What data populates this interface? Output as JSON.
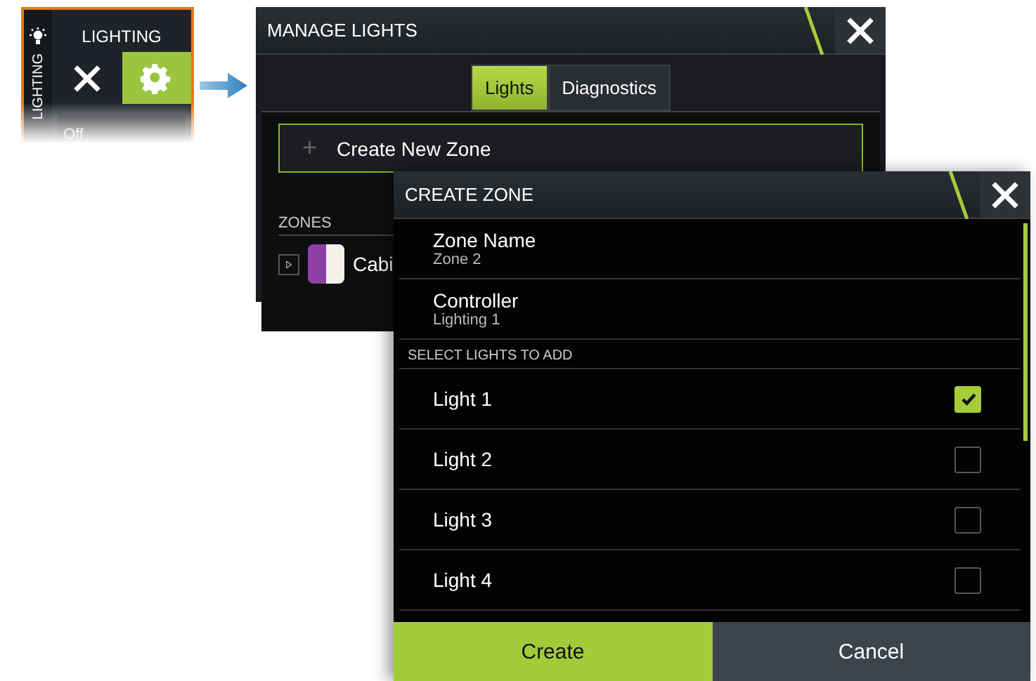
{
  "lighting_panel": {
    "side_label": "LIGHTING",
    "title": "LIGHTING",
    "buttons": [
      {
        "kind": "close",
        "selected": false
      },
      {
        "kind": "settings",
        "selected": true
      }
    ],
    "value": "Off"
  },
  "manage_lights": {
    "title": "MANAGE LIGHTS",
    "tabs": [
      {
        "label": "Lights",
        "selected": true
      },
      {
        "label": "Diagnostics",
        "selected": false
      }
    ],
    "create_button": {
      "icon": "+",
      "label": "Create New Zone"
    },
    "zones_header": "ZONES",
    "zones": [
      {
        "name": "Cabi",
        "color": "#8e3fa6"
      }
    ]
  },
  "create_zone": {
    "title": "CREATE ZONE",
    "fields": [
      {
        "label": "Zone Name",
        "value": "Zone 2"
      },
      {
        "label": "Controller",
        "value": "Lighting 1"
      }
    ],
    "section_header": "SELECT LIGHTS TO ADD",
    "lights": [
      {
        "name": "Light 1",
        "checked": true
      },
      {
        "name": "Light 2",
        "checked": false
      },
      {
        "name": "Light 3",
        "checked": false
      },
      {
        "name": "Light 4",
        "checked": false
      }
    ],
    "buttons": [
      {
        "label": "Create",
        "kind": "primary"
      },
      {
        "label": "Cancel",
        "kind": "secondary"
      }
    ]
  }
}
